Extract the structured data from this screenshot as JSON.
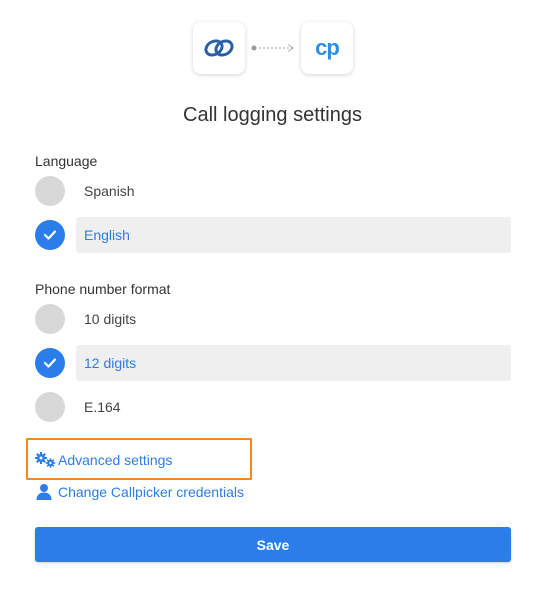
{
  "header": {
    "left_logo_icon": "zoho-link-icon",
    "right_logo_icon": "callpicker-cp-icon",
    "connector_icon": "dotted-arrow-icon",
    "right_logo_text": "cp",
    "title": "Call logging settings"
  },
  "language": {
    "label": "Language",
    "options": [
      {
        "label": "Spanish",
        "selected": false
      },
      {
        "label": "English",
        "selected": true
      }
    ]
  },
  "phone_format": {
    "label": "Phone number format",
    "options": [
      {
        "label": "10 digits",
        "selected": false
      },
      {
        "label": "12 digits",
        "selected": true
      },
      {
        "label": "E.164",
        "selected": false
      }
    ]
  },
  "links": {
    "advanced": {
      "label": "Advanced settings",
      "icon": "gears-icon"
    },
    "credentials": {
      "label": "Change Callpicker credentials",
      "icon": "user-icon"
    }
  },
  "save_label": "Save",
  "colors": {
    "accent": "#2b7de9",
    "highlight": "#f08a24",
    "radio_off": "#d8d8d8",
    "selected_bg": "#efefef"
  }
}
